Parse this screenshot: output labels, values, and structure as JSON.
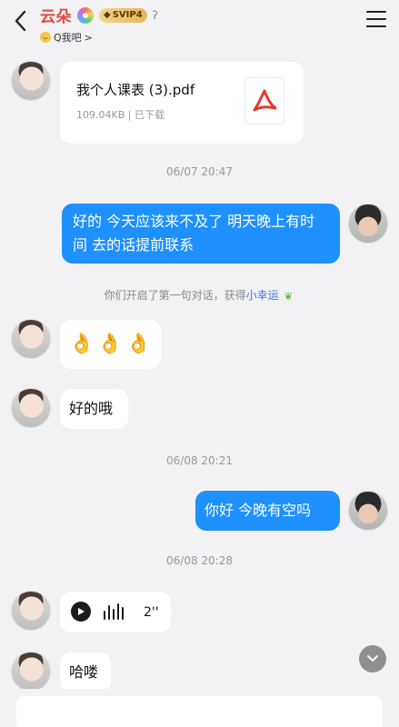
{
  "header": {
    "title": "云朵",
    "svip_label": "SVIP4",
    "subtitle": "Q我吧",
    "subtitle_arrow": ">"
  },
  "messages": {
    "file": {
      "name": "我个人课表 (3).pdf",
      "meta": "109.04KB | 已下载"
    },
    "ts1": "06/07 20:47",
    "msg1": "好的 今天应该来不及了 明天晚上有时间 去的话提前联系",
    "notice_prefix": "你们开启了第一句对话，获得",
    "notice_link": "小幸运",
    "emoji_ok": "👌",
    "msg2": "好的哦",
    "ts2": "06/08 20:21",
    "msg3": "你好  今晚有空吗",
    "ts3": "06/08 20:28",
    "voice_duration": "2''",
    "msg4": "哈喽"
  },
  "colors": {
    "accent_blue": "#1e90ff",
    "title_red": "#e0483c",
    "background": "#f2f2f4"
  },
  "icons": {
    "back": "chevron-left-icon",
    "menu": "hamburger-menu-icon",
    "pdf": "pdf-file-icon",
    "play": "play-icon",
    "scroll_down": "chevron-down-icon"
  }
}
